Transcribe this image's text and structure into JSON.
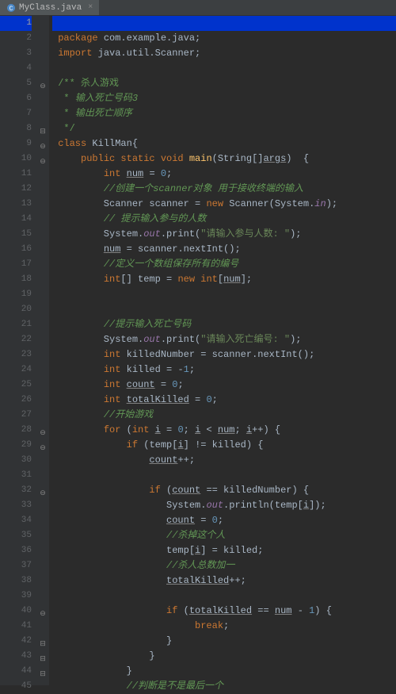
{
  "tab": {
    "filename": "MyClass.java",
    "close": "×"
  },
  "lines": [
    {
      "n": 1,
      "hl": true,
      "c": ""
    },
    {
      "n": 2,
      "c": " <span class='kw'>package</span> com.example.java<span class='pun'>;</span>"
    },
    {
      "n": 3,
      "c": " <span class='kw'>import</span> java.util.Scanner<span class='pun'>;</span>"
    },
    {
      "n": 4,
      "c": ""
    },
    {
      "n": 5,
      "fold": "⊖",
      "c": " <span class='doc'>/** 杀人游戏</span>"
    },
    {
      "n": 6,
      "c": "  <span class='doc'>*</span> <span class='doctag'>输入死亡号码3</span>"
    },
    {
      "n": 7,
      "c": "  <span class='doc'>*</span> <span class='doctag'>输出死亡顺序</span>"
    },
    {
      "n": 8,
      "fold": "⊟",
      "c": "  <span class='doc'>*/</span>"
    },
    {
      "n": 9,
      "run": true,
      "fold": "⊖",
      "c": " <span class='kw'>class</span> KillMan<span class='pun'>{</span>"
    },
    {
      "n": 10,
      "run": true,
      "fold": "⊖",
      "c": "     <span class='kw'>public static void</span> <span class='fn'>main</span><span class='pun'>(</span>String<span class='pun'>[]</span><span class='wrn'>args</span><span class='pun'>)</span>  <span class='pun'>{</span>"
    },
    {
      "n": 11,
      "c": "         <span class='kw'>int</span> <span class='wrn'>num</span> <span class='pun'>=</span> <span class='num'>0</span><span class='pun'>;</span>"
    },
    {
      "n": 12,
      "c": "         <span class='com'>//创建一个scanner对象 用于接收终端的输入</span>"
    },
    {
      "n": 13,
      "c": "         Scanner scanner <span class='pun'>=</span> <span class='kw'>new</span> Scanner<span class='pun'>(</span>System.<span class='fld'>in</span><span class='pun'>);</span>"
    },
    {
      "n": 14,
      "c": "         <span class='com'>// 提示输入参与的人数</span>"
    },
    {
      "n": 15,
      "c": "         System.<span class='fld'>out</span>.print<span class='pun'>(</span><span class='str'>\"请输入参与人数: \"</span><span class='pun'>);</span>"
    },
    {
      "n": 16,
      "c": "         <span class='wrn'>num</span> <span class='pun'>=</span> scanner.nextInt<span class='pun'>();</span>"
    },
    {
      "n": 17,
      "c": "         <span class='com'>//定义一个数组保存所有的编号</span>"
    },
    {
      "n": 18,
      "c": "         <span class='kw'>int</span><span class='pun'>[]</span> temp <span class='pun'>=</span> <span class='kw'>new int</span><span class='pun'>[</span><span class='wrn'>num</span><span class='pun'>];</span>"
    },
    {
      "n": 19,
      "c": ""
    },
    {
      "n": 20,
      "c": ""
    },
    {
      "n": 21,
      "c": "         <span class='com'>//提示输入死亡号码</span>"
    },
    {
      "n": 22,
      "c": "         System.<span class='fld'>out</span>.print<span class='pun'>(</span><span class='str'>\"请输入死亡编号: \"</span><span class='pun'>);</span>"
    },
    {
      "n": 23,
      "c": "         <span class='kw'>int</span> killedNumber <span class='pun'>=</span> scanner.nextInt<span class='pun'>();</span>"
    },
    {
      "n": 24,
      "c": "         <span class='kw'>int</span> killed <span class='pun'>=</span> <span class='pun'>-</span><span class='num'>1</span><span class='pun'>;</span>"
    },
    {
      "n": 25,
      "c": "         <span class='kw'>int</span> <span class='wrn'>count</span> <span class='pun'>=</span> <span class='num'>0</span><span class='pun'>;</span>"
    },
    {
      "n": 26,
      "c": "         <span class='kw'>int</span> <span class='wrn'>totalKilled</span> <span class='pun'>=</span> <span class='num'>0</span><span class='pun'>;</span>"
    },
    {
      "n": 27,
      "c": "         <span class='com'>//开始游戏</span>"
    },
    {
      "n": 28,
      "fold": "⊖",
      "c": "         <span class='kw'>for</span> <span class='pun'>(</span><span class='kw'>int</span> <span class='wrn'>i</span> <span class='pun'>=</span> <span class='num'>0</span><span class='pun'>;</span> <span class='wrn'>i</span> <span class='pun'>&lt;</span> <span class='wrn'>num</span><span class='pun'>;</span> <span class='wrn'>i</span><span class='pun'>++)</span> <span class='pun'>{</span>"
    },
    {
      "n": 29,
      "fold": "⊖",
      "c": "             <span class='kw'>if</span> <span class='pun'>(</span>temp<span class='pun'>[</span><span class='wrn'>i</span><span class='pun'>]</span> <span class='pun'>!=</span> killed<span class='pun'>)</span> <span class='pun'>{</span>"
    },
    {
      "n": 30,
      "c": "                 <span class='wrn'>count</span><span class='pun'>++;</span>"
    },
    {
      "n": 31,
      "c": ""
    },
    {
      "n": 32,
      "fold": "⊖",
      "c": "                 <span class='kw'>if</span> <span class='pun'>(</span><span class='wrn'>count</span> <span class='pun'>==</span> killedNumber<span class='pun'>)</span> <span class='pun'>{</span>"
    },
    {
      "n": 33,
      "c": "                    System.<span class='fld'>out</span>.println<span class='pun'>(</span>temp<span class='pun'>[</span><span class='wrn'>i</span><span class='pun'>]);</span>"
    },
    {
      "n": 34,
      "c": "                    <span class='wrn'>count</span> <span class='pun'>=</span> <span class='num'>0</span><span class='pun'>;</span>"
    },
    {
      "n": 35,
      "c": "                    <span class='com'>//杀掉这个人</span>"
    },
    {
      "n": 36,
      "c": "                    temp<span class='pun'>[</span><span class='wrn'>i</span><span class='pun'>]</span> <span class='pun'>=</span> killed<span class='pun'>;</span>"
    },
    {
      "n": 37,
      "c": "                    <span class='com'>//杀人总数加一</span>"
    },
    {
      "n": 38,
      "c": "                    <span class='wrn'>totalKilled</span><span class='pun'>++;</span>"
    },
    {
      "n": 39,
      "c": ""
    },
    {
      "n": 40,
      "fold": "⊖",
      "c": "                    <span class='kw'>if</span> <span class='pun'>(</span><span class='wrn'>totalKilled</span> <span class='pun'>==</span> <span class='wrn'>num</span> <span class='pun'>-</span> <span class='num'>1</span><span class='pun'>)</span> <span class='pun'>{</span>"
    },
    {
      "n": 41,
      "c": "                         <span class='kw'>break</span><span class='pun'>;</span>"
    },
    {
      "n": 42,
      "fold": "⊟",
      "c": "                    <span class='pun'>}</span>"
    },
    {
      "n": 43,
      "fold": "⊟",
      "c": "                 <span class='pun'>}</span>"
    },
    {
      "n": 44,
      "fold": "⊟",
      "c": "             <span class='pun'>}</span>"
    },
    {
      "n": 45,
      "c": "             <span class='com'>//判断是不是最后一个</span>"
    }
  ]
}
